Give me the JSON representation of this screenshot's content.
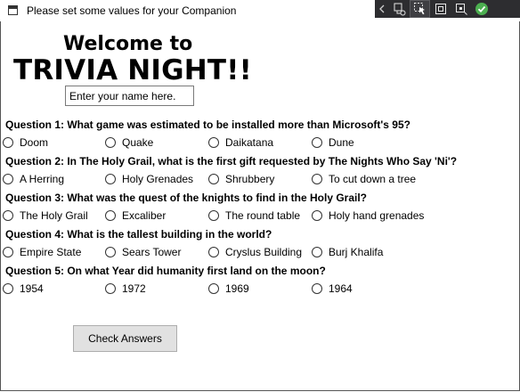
{
  "window": {
    "title": "Please set some values for your Companion"
  },
  "debug_toolbar": {
    "icons": [
      "live-visual-tree-icon",
      "select-element-icon",
      "display-layout-adorners-icon",
      "track-focus-icon",
      "binding-failures-ok-icon",
      "collapse-toolbar-icon"
    ],
    "status_color": "#4caf50"
  },
  "header": {
    "welcome": "Welcome to",
    "title": "TRIVIA NIGHT!!"
  },
  "name_input": {
    "value": "Enter your name here."
  },
  "questions": [
    {
      "text": "Question 1: What game was estimated to be installed more than Microsoft's 95?",
      "options": [
        "Doom",
        "Quake",
        "Daikatana",
        "Dune"
      ]
    },
    {
      "text": "Question 2: In The Holy Grail, what is the first gift requested by The Nights Who Say 'Ni'?",
      "options": [
        "A Herring",
        "Holy Grenades",
        "Shrubbery",
        "To cut down a tree"
      ]
    },
    {
      "text": "Question 3: What was the quest of the knights to find in the Holy Grail?",
      "options": [
        "The Holy Grail",
        "Excaliber",
        "The round table",
        "Holy hand grenades"
      ]
    },
    {
      "text": "Question 4: What is the tallest building in the world?",
      "options": [
        "Empire State",
        "Sears Tower",
        "Cryslus Building",
        "Burj Khalifa"
      ]
    },
    {
      "text": "Question 5: On what Year did humanity first land on the moon?",
      "options": [
        "1954",
        "1972",
        "1969",
        "1964"
      ]
    }
  ],
  "check_button": {
    "label": "Check Answers"
  }
}
